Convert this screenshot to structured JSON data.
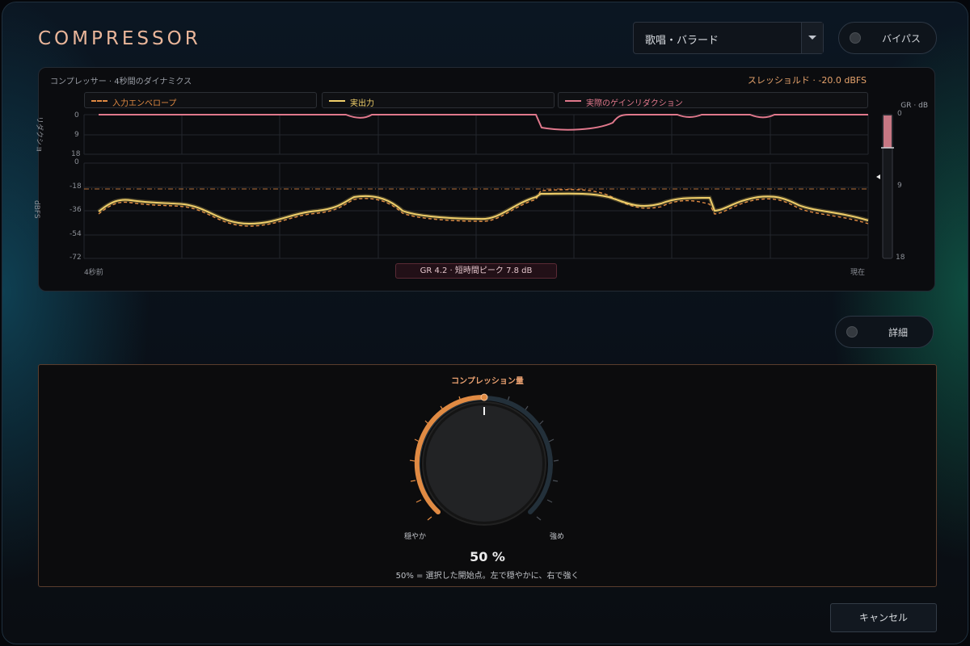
{
  "app": {
    "title": "COMPRESSOR"
  },
  "header": {
    "preset": "歌唱・バラード",
    "bypass_label": "バイパス"
  },
  "scope": {
    "title": "コンプレッサー · 4秒間のダイナミクス",
    "threshold_text": "スレッショルド · -20.0 dBFS",
    "legend": [
      {
        "label": "入力エンベロープ",
        "color": "#e08a43",
        "style": "dashed"
      },
      {
        "label": "実出力",
        "color": "#f0cf6a",
        "style": "solid"
      },
      {
        "label": "実際のゲインリダクション",
        "color": "#e0788c",
        "style": "solid"
      }
    ],
    "gr_axis_label": "リダクショ",
    "gr_ticks": [
      "0",
      "9",
      "18"
    ],
    "level_axis_label": "dBFS",
    "level_ticks": [
      "0",
      "-18",
      "-36",
      "-54",
      "-72"
    ],
    "time_start": "4秒前",
    "time_end": "現在",
    "gr_badge": "GR 4.2 · 短時間ピーク 7.8 dB",
    "meter": {
      "label": "GR · dB",
      "ticks": [
        "0",
        "9",
        "18"
      ],
      "value_db": 4.2
    }
  },
  "detail_label": "詳細",
  "compression": {
    "title": "コンプレッション量",
    "value_text": "50 %",
    "value_fraction": 0.5,
    "soft_label": "穏やか",
    "hard_label": "強め",
    "hint": "50% = 選択した開始点。左で穏やかに、右で強く"
  },
  "footer": {
    "cancel_label": "キャンセル"
  },
  "colors": {
    "accent": "#e08a43",
    "output": "#f0cf6a",
    "gain_reduction": "#e0788c",
    "title": "#eab69a"
  }
}
